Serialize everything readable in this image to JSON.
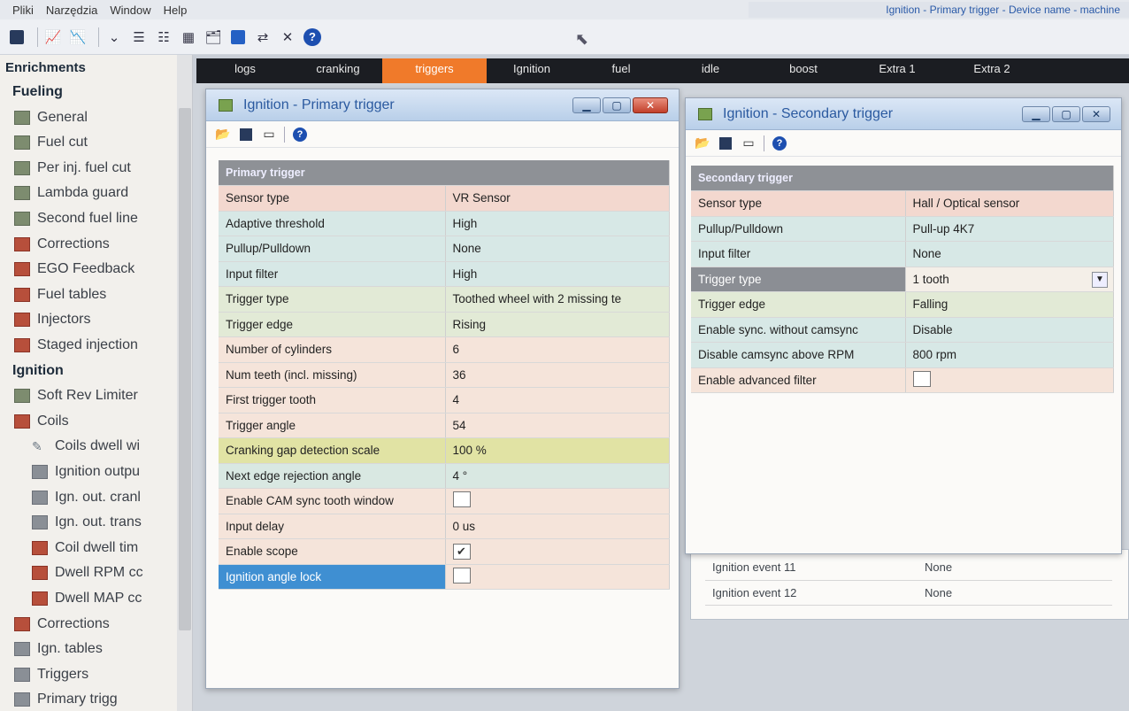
{
  "menu": {
    "items": [
      "Pliki",
      "Narzędzia",
      "Window",
      "Help"
    ],
    "first": "Pliki",
    "title_tail": "Ignition - Primary trigger - Device name - machine"
  },
  "toolbar": {
    "icons": [
      "save-icon",
      "save-as-icon",
      "chart-icon",
      "list-icon",
      "list2-icon",
      "folder-icon",
      "save2-icon",
      "swap-icon",
      "close-icon",
      "help-icon"
    ]
  },
  "sidebar": {
    "header": "Enrichments",
    "items": [
      {
        "label": "Fueling",
        "cat": true
      },
      {
        "label": "General",
        "icon": "green"
      },
      {
        "label": "Fuel cut",
        "icon": "green"
      },
      {
        "label": "Per inj. fuel cut",
        "icon": "green"
      },
      {
        "label": "Lambda guard",
        "icon": "green"
      },
      {
        "label": "Second fuel line",
        "icon": "green"
      },
      {
        "label": "Corrections",
        "icon": "red"
      },
      {
        "label": "EGO Feedback",
        "icon": "red"
      },
      {
        "label": "Fuel tables",
        "icon": "red"
      },
      {
        "label": "Injectors",
        "icon": "red"
      },
      {
        "label": "Staged injection",
        "icon": "red"
      },
      {
        "label": "Ignition",
        "cat": true
      },
      {
        "label": "Soft Rev Limiter",
        "icon": "green"
      },
      {
        "label": "Coils",
        "icon": "red"
      },
      {
        "label": "Coils dwell wi",
        "icon": "pen"
      },
      {
        "label": "Ignition outpu",
        "icon": "gray"
      },
      {
        "label": "Ign. out. cranl",
        "icon": "gray"
      },
      {
        "label": "Ign. out. trans",
        "icon": "gray"
      },
      {
        "label": "Coil dwell tim",
        "icon": "red"
      },
      {
        "label": "Dwell RPM cc",
        "icon": "red"
      },
      {
        "label": "Dwell MAP cc",
        "icon": "red"
      },
      {
        "label": "Corrections",
        "icon": "red"
      },
      {
        "label": "Ign. tables",
        "icon": "gray"
      },
      {
        "label": "Triggers",
        "icon": "gray"
      },
      {
        "label": "Primary trigg",
        "icon": "gray"
      }
    ]
  },
  "tabs": [
    "logs",
    "cranking",
    "triggers",
    "Ignition",
    "fuel",
    "idle",
    "boost",
    "Extra 1",
    "Extra 2"
  ],
  "active_tab": "triggers",
  "primary": {
    "title": "Ignition - Primary trigger",
    "header": "Primary trigger",
    "rows": [
      {
        "label": "Sensor type",
        "value": "VR Sensor",
        "bg": "#f3d8cf"
      },
      {
        "label": "Adaptive threshold",
        "value": "High",
        "bg": "#d7e8e6"
      },
      {
        "label": "Pullup/Pulldown",
        "value": "None",
        "bg": "#d7e8e6"
      },
      {
        "label": "Input filter",
        "value": "High",
        "bg": "#d7e8e6"
      },
      {
        "label": "Trigger type",
        "value": "Toothed wheel with 2 missing te",
        "bg": "#e2ead6"
      },
      {
        "label": "Trigger edge",
        "value": "Rising",
        "bg": "#e2ead6"
      },
      {
        "label": "Number of cylinders",
        "value": "6",
        "bg": "#f5e4da"
      },
      {
        "label": "Num teeth (incl. missing)",
        "value": "36",
        "bg": "#f5e4da"
      },
      {
        "label": "First trigger tooth",
        "value": "4",
        "bg": "#f5e4da"
      },
      {
        "label": "Trigger angle",
        "value": "54",
        "bg": "#f5e4da"
      },
      {
        "label": "Cranking gap detection scale",
        "value": "100 %",
        "bg": "#e1e3a4"
      },
      {
        "label": "Next edge rejection angle",
        "value": "4 °",
        "bg": "#d9e8e2"
      },
      {
        "label": "Enable CAM sync tooth window",
        "value": "",
        "check": false,
        "bg": "#f5e4da"
      },
      {
        "label": "Input delay",
        "value": "0 us",
        "bg": "#f5e4da"
      },
      {
        "label": "Enable scope",
        "value": "",
        "check": true,
        "bg": "#f5e4da"
      },
      {
        "label": "Ignition angle lock",
        "value": "",
        "check": false,
        "bg": "#f5e4da",
        "selected": true
      }
    ]
  },
  "secondary": {
    "title": "Ignition - Secondary trigger",
    "header": "Secondary trigger",
    "rows": [
      {
        "label": "Sensor type",
        "value": "Hall / Optical sensor",
        "bg": "#f3d8cf"
      },
      {
        "label": "Pullup/Pulldown",
        "value": "Pull-up 4K7",
        "bg": "#d7e8e6"
      },
      {
        "label": "Input filter",
        "value": "None",
        "bg": "#d7e8e6"
      },
      {
        "label": "Trigger type",
        "value": "1 tooth",
        "bg": "#f4efe8",
        "selected_gray": true,
        "dropdown": true
      },
      {
        "label": "Trigger edge",
        "value": "Falling",
        "bg": "#e2ead6"
      },
      {
        "label": "Enable sync. without camsync",
        "value": "Disable",
        "bg": "#d7e8e6"
      },
      {
        "label": "Disable camsync above RPM",
        "value": "800 rpm",
        "bg": "#d7e8e6"
      },
      {
        "label": "Enable advanced filter",
        "value": "",
        "check": false,
        "bg": "#f5e4da"
      }
    ]
  },
  "behind": {
    "rows": [
      {
        "label": "Ignition event 11",
        "value": "None"
      },
      {
        "label": "Ignition event 12",
        "value": "None"
      }
    ]
  }
}
